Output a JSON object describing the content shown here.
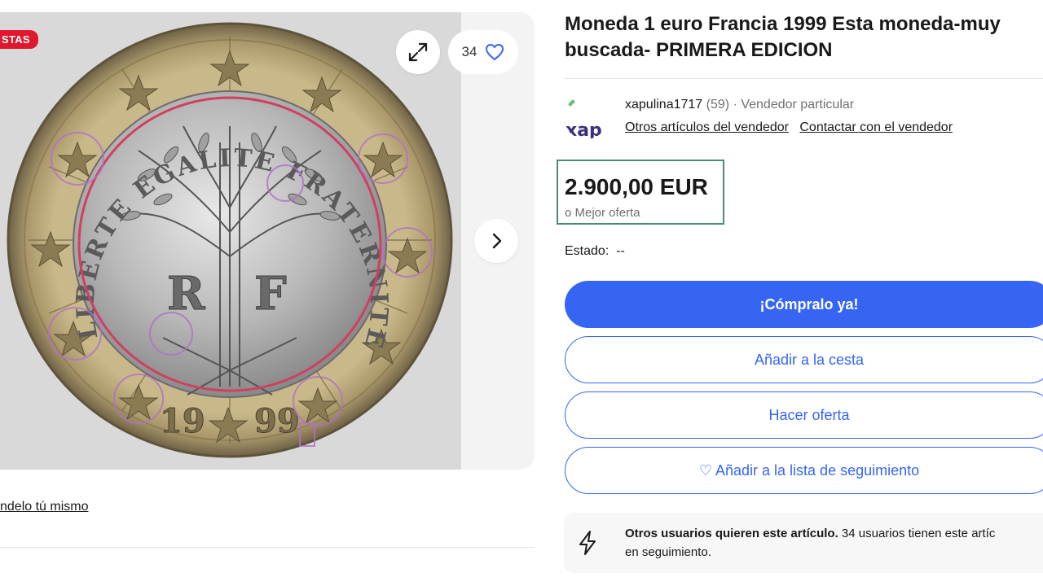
{
  "gallery": {
    "badge": "STAS",
    "watch_count": "34",
    "icons": {
      "expand": "expand-icon",
      "watch": "heart-icon",
      "next": "chevron-right-icon"
    },
    "coin_text": {
      "ring": "LIBERTE EGALITE FRATERNITE",
      "letter_r": "R",
      "letter_f": "F",
      "year_left": "19",
      "year_right": "99"
    }
  },
  "left_link": "ndelo tú mismo",
  "listing": {
    "title": "Moneda 1 euro Francia 1999 Esta moneda-muy buscada- PRIMERA EDICION"
  },
  "seller": {
    "avatar_text": "xap",
    "name": "xapulina1717",
    "feedback": "(59)",
    "type": "· Vendedor particular",
    "link_items": "Otros artículos del vendedor",
    "link_contact": "Contactar con el vendedor"
  },
  "price": {
    "amount": "2.900,00 EUR",
    "best_offer": "o Mejor oferta"
  },
  "condition": {
    "label": "Estado:",
    "value": "--"
  },
  "actions": {
    "buy_now": "¡Cómpralo ya!",
    "add_to_cart": "Añadir a la cesta",
    "make_offer": "Hacer oferta",
    "watchlist": "♡ Añadir a la lista de seguimiento"
  },
  "notice": {
    "bold": "Otros usuarios quieren este artículo.",
    "text": " 34 usuarios tienen este artíc",
    "line2": "en seguimiento.",
    "icon": "lightning-icon"
  },
  "colors": {
    "accent": "#3665f3",
    "badge": "#e0182d",
    "price_box": "#4e8c6f"
  }
}
